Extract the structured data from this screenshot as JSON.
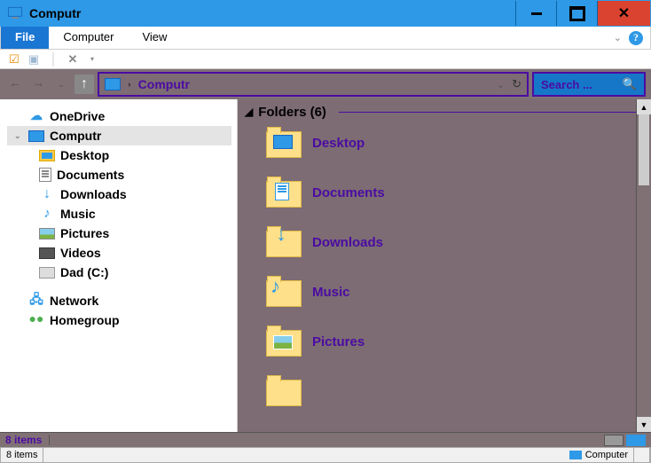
{
  "title": "Computr",
  "ribbon": {
    "file": "File",
    "computer": "Computer",
    "view": "View"
  },
  "address": {
    "path": "Computr",
    "search_placeholder": "Search ..."
  },
  "nav": {
    "onedrive": "OneDrive",
    "computr": "Computr",
    "children": [
      "Desktop",
      "Documents",
      "Downloads",
      "Music",
      "Pictures",
      "Videos",
      "Dad (C:)"
    ],
    "network": "Network",
    "homegroup": "Homegroup"
  },
  "content": {
    "section": "Folders (6)",
    "tiles": [
      "Desktop",
      "Documents",
      "Downloads",
      "Music",
      "Pictures"
    ]
  },
  "status": {
    "items": "8 items",
    "app_items": "8 items",
    "app_label": "Computer"
  }
}
